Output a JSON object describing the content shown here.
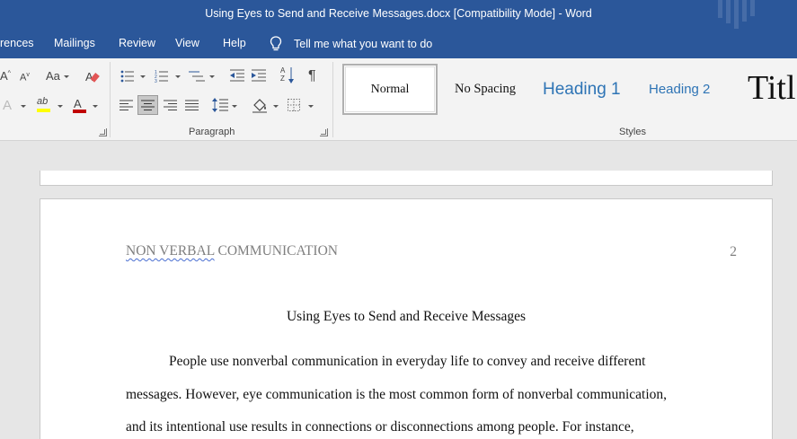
{
  "window": {
    "title": "Using Eyes to Send and Receive Messages.docx [Compatibility Mode]  -  Word"
  },
  "tabs": [
    {
      "label": "rences"
    },
    {
      "label": "Mailings"
    },
    {
      "label": "Review"
    },
    {
      "label": "View"
    },
    {
      "label": "Help"
    }
  ],
  "tell_me": {
    "text": "Tell me what you want to do",
    "icon": "lightbulb-icon"
  },
  "ribbon": {
    "font_group": {
      "grow_font_glyph": "A",
      "shrink_font_glyph": "A",
      "change_case_glyph": "Aa",
      "text_effects_glyph": "A",
      "highlight_glyph": "ab",
      "font_color_glyph": "A",
      "font_color": "#c00000",
      "highlight_color": "#ffff00"
    },
    "paragraph_group": {
      "label": "Paragraph",
      "sort_glyph": "A Z",
      "show_marks_glyph": "¶"
    },
    "styles_group": {
      "label": "Styles",
      "items": [
        {
          "label": "Normal"
        },
        {
          "label": "No Spacing"
        },
        {
          "label": "Heading 1"
        },
        {
          "label": "Heading 2"
        },
        {
          "label": "Titl"
        }
      ]
    }
  },
  "document": {
    "header_word1": "NON VERBAL",
    "header_word2": " COMMUNICATION",
    "page_number": "2",
    "title": "Using Eyes to Send and Receive Messages",
    "lines": [
      "People use nonverbal communication in everyday life to convey and receive different",
      "messages. However, eye communication is the most common form of nonverbal communication,",
      "and its intentional use results in connections or disconnections among people. For instance,"
    ]
  }
}
